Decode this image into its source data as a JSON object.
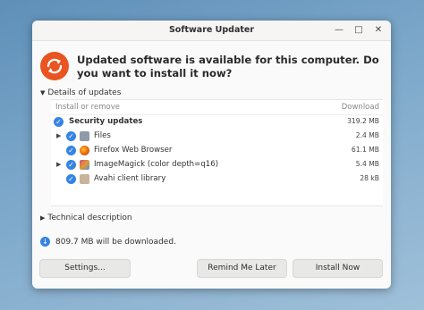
{
  "window": {
    "title": "Software Updater"
  },
  "header": {
    "message": "Updated software is available for this computer. Do you want to install it now?"
  },
  "details_toggle": "Details of updates",
  "columns": {
    "install": "Install or remove",
    "download": "Download"
  },
  "updates": {
    "group": {
      "label": "Security updates",
      "size": "319.2 MB",
      "checked": true
    },
    "items": [
      {
        "label": "Files",
        "size": "2.4 MB",
        "icon": "folder-icon",
        "expandable": true
      },
      {
        "label": "Firefox Web Browser",
        "size": "61.1 MB",
        "icon": "firefox-icon",
        "expandable": false
      },
      {
        "label": "ImageMagick (color depth=q16)",
        "size": "5.4 MB",
        "icon": "imagemagick-icon",
        "expandable": true
      },
      {
        "label": "Avahi client library",
        "size": "28 kB",
        "icon": "package-icon",
        "expandable": false
      }
    ]
  },
  "technical_toggle": "Technical description",
  "download_info": "809.7 MB will be downloaded.",
  "buttons": {
    "settings": "Settings...",
    "remind": "Remind Me Later",
    "install": "Install Now"
  },
  "colors": {
    "accent": "#3584e4",
    "brand": "#e95420"
  }
}
